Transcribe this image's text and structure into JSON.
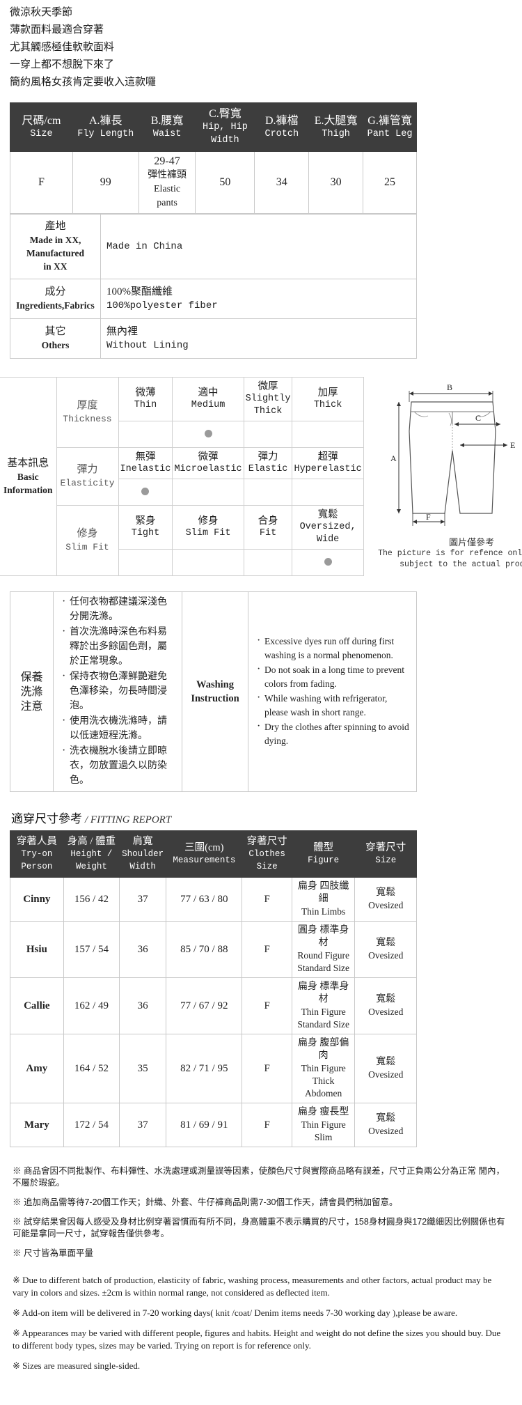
{
  "intro": {
    "lines": [
      "微涼秋天季節",
      "薄款面料最適合穿著",
      "尤其觸感極佳軟軟面料",
      "一穿上都不想脫下來了",
      "簡約風格女孩肯定要收入這款囉"
    ]
  },
  "spec_table": {
    "headers": [
      {
        "cn": "尺碼/cm",
        "en": "Size"
      },
      {
        "cn": "A.褲長",
        "en": "Fly Length"
      },
      {
        "cn": "B.腰寬",
        "en": "Waist"
      },
      {
        "cn": "C.臀寬",
        "en": "Hip, Hip Width"
      },
      {
        "cn": "D.褲檔",
        "en": "Crotch"
      },
      {
        "cn": "E.大腿寬",
        "en": "Thigh"
      },
      {
        "cn": "G.褲管寬",
        "en": "Pant Leg"
      }
    ],
    "row": {
      "size": "F",
      "fly_length": "99",
      "waist_range": "29-47",
      "waist_cn": "彈性褲頭",
      "waist_en1": "Elastic",
      "waist_en2": "pants",
      "hip": "50",
      "crotch": "34",
      "thigh": "30",
      "pant_leg": "25"
    }
  },
  "info_rows": [
    {
      "label_cn": "產地",
      "label_en1": "Made in XX,",
      "label_en2": "Manufactured",
      "label_en3": "in XX",
      "value_cn": "",
      "value_en": "Made in China"
    },
    {
      "label_cn": "成分",
      "label_en1": "Ingredients,Fabrics",
      "label_en2": "",
      "label_en3": "",
      "value_cn": "100%聚酯纖維",
      "value_en": "100%polyester fiber"
    },
    {
      "label_cn": "其它",
      "label_en1": "Others",
      "label_en2": "",
      "label_en3": "",
      "value_cn": "無內裡",
      "value_en": "Without Lining"
    }
  ],
  "basic": {
    "side_cn": "基本訊息",
    "side_en1": "Basic",
    "side_en2": "Information",
    "rows": [
      {
        "label_cn": "厚度",
        "label_en": "Thickness",
        "options": [
          {
            "cn": "微薄",
            "en": "Thin",
            "selected": false
          },
          {
            "cn": "適中",
            "en": "Medium",
            "selected": true
          },
          {
            "cn": "微厚",
            "en": "Slightly Thick",
            "selected": false
          },
          {
            "cn": "加厚",
            "en": "Thick",
            "selected": false
          }
        ]
      },
      {
        "label_cn": "彈力",
        "label_en": "Elasticity",
        "options": [
          {
            "cn": "無彈",
            "en": "Inelastic",
            "selected": true
          },
          {
            "cn": "微彈",
            "en": "Microelastic",
            "selected": false
          },
          {
            "cn": "彈力",
            "en": "Elastic",
            "selected": false
          },
          {
            "cn": "超彈",
            "en": "Hyperelastic",
            "selected": false
          }
        ]
      },
      {
        "label_cn": "修身",
        "label_en": "Slim Fit",
        "options": [
          {
            "cn": "緊身",
            "en": "Tight",
            "selected": false
          },
          {
            "cn": "修身",
            "en": "Slim Fit",
            "selected": false
          },
          {
            "cn": "合身",
            "en": "Fit",
            "selected": false
          },
          {
            "cn": "寬鬆",
            "en": "Oversized, Wide",
            "selected": true
          }
        ]
      }
    ],
    "diagram_labels": {
      "a": "A",
      "b": "B",
      "c": "C",
      "e": "E",
      "f": "F"
    },
    "diagram_note_cn": "圖片僅參考",
    "diagram_note_en1": "The picture is for refence only. Please",
    "diagram_note_en2": "subject to the actual product."
  },
  "washing": {
    "side_cn1": "保養",
    "side_cn2": "洗滌",
    "side_cn3": "注意",
    "side_en1": "Washing",
    "side_en2": "Instruction",
    "items_cn": [
      "任何衣物都建議深淺色分開洗滌。",
      "首次洗滌時深色布料易釋於出多餘固色劑，屬於正常現象。",
      "保持衣物色澤鮮艷避免色澤移染，勿長時間浸泡。",
      "使用洗衣機洗滌時，請以低速短程洗滌。",
      "洗衣機脫水後請立即晾衣，勿放置過久以防染色。"
    ],
    "items_en": [
      "Excessive dyes run off during first washing is a normal phenomenon.",
      "Do not soak in a long time to prevent colors from fading.",
      "While washing with refrigerator, please wash in short range.",
      "Dry the clothes after spinning to avoid dying."
    ]
  },
  "fitting": {
    "title_cn": "適穿尺寸參考",
    "title_en": "/ FITTING REPORT",
    "headers": [
      {
        "cn": "穿著人員",
        "en": "Try-on Person"
      },
      {
        "cn": "身高 / 體重",
        "en": "Height / Weight"
      },
      {
        "cn": "肩寬",
        "en": "Shoulder Width"
      },
      {
        "cn": "三圍(cm)",
        "en": "Measurements"
      },
      {
        "cn": "穿著尺寸",
        "en": "Clothes Size"
      },
      {
        "cn": "體型",
        "en": "Figure"
      },
      {
        "cn": "穿著尺寸",
        "en": "Size"
      }
    ],
    "rows": [
      {
        "person": "Cinny",
        "height_weight": "156 / 42",
        "shoulder": "37",
        "measurements": "77 / 63 / 80",
        "clothes_size": "F",
        "figure_cn": "扁身 四肢纖細",
        "figure_en": "Thin Limbs",
        "figure_cn2": "",
        "figure_en2": "",
        "size_cn": "寬鬆",
        "size_en": "Ovesized"
      },
      {
        "person": "Hsiu",
        "height_weight": "157 / 54",
        "shoulder": "36",
        "measurements": "85 / 70 / 88",
        "clothes_size": "F",
        "figure_cn": "圓身 標準身材",
        "figure_en": "Round Figure",
        "figure_cn2": "",
        "figure_en2": "Standard Size",
        "size_cn": "寬鬆",
        "size_en": "Ovesized"
      },
      {
        "person": "Callie",
        "height_weight": "162 / 49",
        "shoulder": "36",
        "measurements": "77 / 67 / 92",
        "clothes_size": "F",
        "figure_cn": "扁身 標準身材",
        "figure_en": "Thin Figure",
        "figure_cn2": "",
        "figure_en2": "Standard Size",
        "size_cn": "寬鬆",
        "size_en": "Ovesized"
      },
      {
        "person": "Amy",
        "height_weight": "164 / 52",
        "shoulder": "35",
        "measurements": "82 / 71 / 95",
        "clothes_size": "F",
        "figure_cn": "扁身 腹部偏肉",
        "figure_en": "Thin Figure",
        "figure_cn2": "",
        "figure_en2": "Thick Abdomen",
        "size_cn": "寬鬆",
        "size_en": "Ovesized"
      },
      {
        "person": "Mary",
        "height_weight": "172 / 54",
        "shoulder": "37",
        "measurements": "81 / 69 / 91",
        "clothes_size": "F",
        "figure_cn": "扁身 瘦長型",
        "figure_en": "Thin Figure",
        "figure_cn2": "",
        "figure_en2": "Slim",
        "size_cn": "寬鬆",
        "size_en": "Ovesized"
      }
    ]
  },
  "notes": {
    "cn": [
      "※ 商品會因不同批製作、布料彈性、水洗處理或測量誤等因素，使顏色尺寸與實際商品略有誤差，尺寸正負兩公分為正常 閒內，不屬於瑕疵。",
      "※ 追加商品需等待7-20個工作天；針織、外套、牛仔褲商品則需7-30個工作天，請會員們稍加留意。",
      "※ 試穿結果會因每人感受及身材比例穿著習慣而有所不同，身高體重不表示購買的尺寸，158身材圓身與172纖細因比例關係也有可能是拿同一尺寸，試穿報告僅供參考。",
      "※ 尺寸皆為單面平量"
    ],
    "en": [
      "※ Due to different batch of production, elasticity of fabric, washing process, measurements and other factors, actual product may be vary in colors and sizes. ±2cm is within normal range, not considered as deflected item.",
      "※ Add-on item will be delivered in 7-20 working days( knit /coat/ Denim items needs 7-30 working day ),please be aware.",
      "※ Appearances may be varied with different people, figures and habits. Height and weight do not define the sizes you should buy. Due to different body types, sizes may be varied. Trying on report is for reference only.",
      "※ Sizes are measured single-sided."
    ]
  }
}
